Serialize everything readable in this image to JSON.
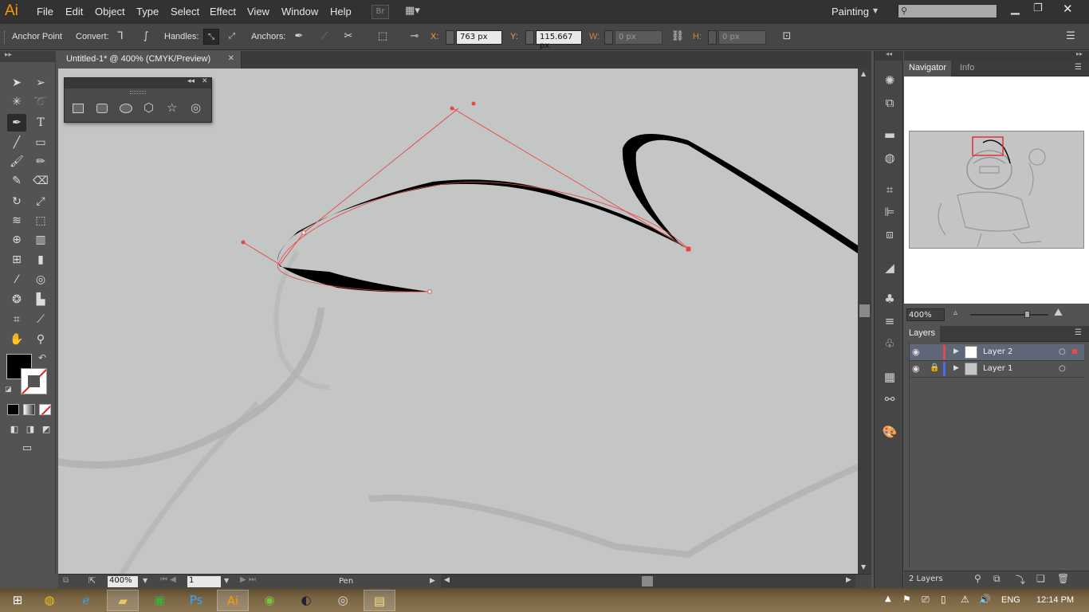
{
  "app": {
    "logo": "Ai",
    "menus": [
      "File",
      "Edit",
      "Object",
      "Type",
      "Select",
      "Effect",
      "View",
      "Window",
      "Help"
    ],
    "bridge_label": "Br",
    "workspace": "Painting",
    "search_placeholder": ""
  },
  "control_bar": {
    "tool_name": "Anchor Point",
    "convert_label": "Convert:",
    "handles_label": "Handles:",
    "anchors_label": "Anchors:",
    "x_label": "X:",
    "x_value": "763 px",
    "y_label": "Y:",
    "y_value": "115.667 px",
    "w_label": "W:",
    "w_value": "0 px",
    "h_label": "H:",
    "h_value": "0 px"
  },
  "document": {
    "tab_title": "Untitled-1* @ 400% (CMYK/Preview)",
    "close_glyph": "✕"
  },
  "status_bar": {
    "zoom": "400%",
    "artboard": "1",
    "tool": "Pen"
  },
  "navigator": {
    "tabs": [
      "Navigator",
      "Info"
    ],
    "zoom": "400%"
  },
  "layers": {
    "tab": "Layers",
    "rows": [
      {
        "name": "Layer 2",
        "color": "#e84a4a",
        "selected": true
      },
      {
        "name": "Layer 1",
        "color": "#4a6ee8",
        "selected": false
      }
    ],
    "count": "2 Layers"
  },
  "taskbar": {
    "language": "ENG",
    "time": "12:14 PM"
  },
  "colors": {
    "accent": "#ff9a00",
    "path_red": "#e84545",
    "canvas": "#c4c6c5"
  }
}
